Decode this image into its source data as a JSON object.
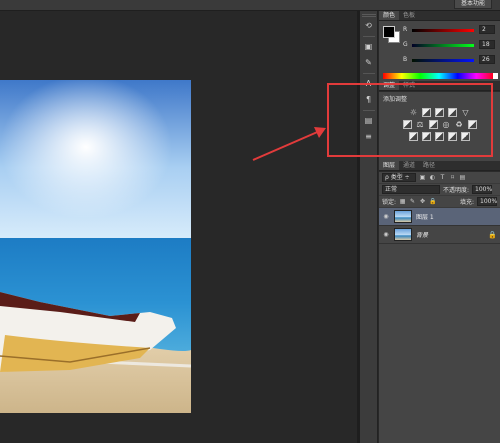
{
  "topbar": {
    "workspace_label": "基本功能"
  },
  "color_panel": {
    "tabs": [
      "颜色",
      "色板"
    ],
    "sliders": [
      {
        "label": "R",
        "value": "2"
      },
      {
        "label": "G",
        "value": "18"
      },
      {
        "label": "B",
        "value": "26"
      }
    ],
    "foreground_color": "#000000",
    "background_color": "#ffffff"
  },
  "adjustments_panel": {
    "tabs": [
      "调整",
      "样式"
    ],
    "title": "添加调整",
    "icons_row1": [
      "brightness-contrast-icon",
      "levels-icon",
      "curves-icon",
      "exposure-icon",
      "vibrance-icon"
    ],
    "icons_row2": [
      "hue-saturation-icon",
      "color-balance-icon",
      "black-white-icon",
      "photo-filter-icon",
      "channel-mixer-icon",
      "color-lookup-icon"
    ],
    "icons_row3": [
      "invert-icon",
      "posterize-icon",
      "threshold-icon",
      "selective-color-icon",
      "gradient-map-icon"
    ]
  },
  "layers_panel": {
    "tabs": [
      "图层",
      "通道",
      "路径"
    ],
    "filter_kind": "类型",
    "blend_mode": "正常",
    "opacity_label": "不透明度:",
    "opacity_value": "100%",
    "lock_label": "锁定:",
    "fill_label": "填充:",
    "fill_value": "100%",
    "layers": [
      {
        "name": "图层 1",
        "selected": true,
        "locked": false
      },
      {
        "name": "背景",
        "selected": false,
        "locked": true
      }
    ]
  },
  "annotation": {
    "highlight_color": "#e23b3b"
  }
}
